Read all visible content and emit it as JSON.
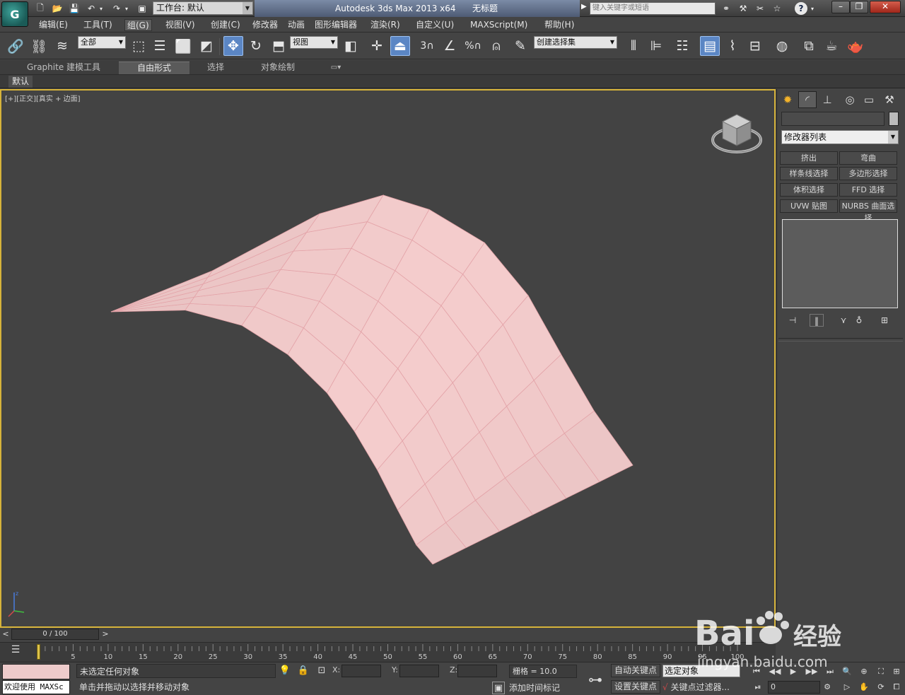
{
  "titlebar": {
    "workspace": "工作台: 默认",
    "app_title": "Autodesk 3ds Max  2013 x64",
    "doc_title": "无标题",
    "search_placeholder": "键入关键字或短语",
    "help": "?"
  },
  "menu": [
    "编辑(E)",
    "工具(T)",
    "组(G)",
    "视图(V)",
    "创建(C)",
    "修改器",
    "动画",
    "图形编辑器",
    "渲染(R)",
    "自定义(U)",
    "MAXScript(M)",
    "帮助(H)"
  ],
  "toolbar": {
    "selection_filter": "全部",
    "reference_coord": "视图",
    "named_selection": "创建选择集",
    "snap_label": "3",
    "percent_label": "%"
  },
  "ribbon": {
    "tabs": [
      "Graphite 建模工具",
      "自由形式",
      "选择",
      "对象绘制"
    ],
    "active_tab": 1,
    "panel_default": "默认"
  },
  "viewport": {
    "label_parts": [
      "[+]",
      "[正交]",
      "[真实 + 边面]"
    ],
    "surface_color": "#f4cccc",
    "edge_color": "#e3a3a8",
    "background": "#434343"
  },
  "command_panel": {
    "modifier_list": "修改器列表",
    "modifier_buttons": [
      "挤出",
      "弯曲",
      "样条线选择",
      "多边形选择",
      "体积选择",
      "FFD 选择",
      "UVW 贴图",
      "NURBS 曲面选择"
    ]
  },
  "timeline": {
    "slider_label": "0 / 100",
    "ticks": [
      "5",
      "10",
      "15",
      "20",
      "25",
      "30",
      "35",
      "40",
      "45",
      "50",
      "55",
      "60",
      "65",
      "70",
      "75",
      "80",
      "85",
      "90",
      "95",
      "100"
    ]
  },
  "status": {
    "maxscript": "欢迎使用 MAXSc",
    "selection_status": "未选定任何对象",
    "prompt": "单击并拖动以选择并移动对象",
    "x_label": "X:",
    "y_label": "Y:",
    "z_label": "Z:",
    "grid": "栅格 = 10.0",
    "add_time_tag": "添加时间标记",
    "auto_key": "自动关键点",
    "set_key": "设置关键点",
    "selected_dropdown": "选定对象",
    "key_filters": "关键点过滤器...",
    "frame": "0"
  },
  "watermark": {
    "brand": "Bai",
    "brand_cn": "经验",
    "url": "jingyan.baidu.com"
  }
}
